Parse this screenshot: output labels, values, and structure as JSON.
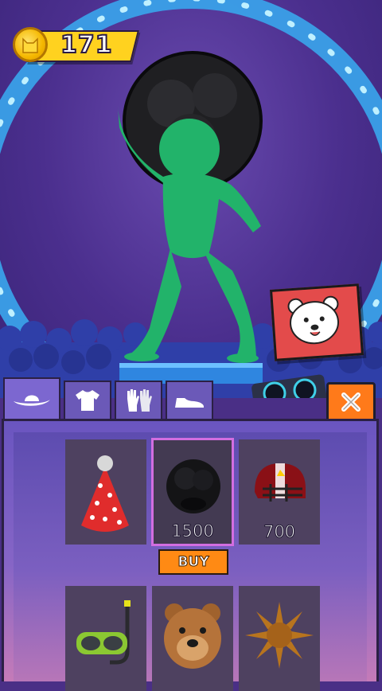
{
  "currency": {
    "coins": "171",
    "icon": "cat-coin-icon"
  },
  "tabs": [
    {
      "id": "hats",
      "icon": "cowboy-hat-icon",
      "active": true
    },
    {
      "id": "shirts",
      "icon": "tshirt-icon",
      "active": false
    },
    {
      "id": "gloves",
      "icon": "gloves-icon",
      "active": false
    },
    {
      "id": "shoes",
      "icon": "shoe-icon",
      "active": false
    }
  ],
  "shop": {
    "items": [
      {
        "name": "party-hat",
        "price": ""
      },
      {
        "name": "afro-wig",
        "price": "1500",
        "selected": true
      },
      {
        "name": "football-helmet",
        "price": "700"
      },
      {
        "name": "snorkel-mask",
        "price": ""
      },
      {
        "name": "bear-mask",
        "price": ""
      },
      {
        "name": "sun-hat",
        "price": ""
      }
    ],
    "buy_label": "BUY"
  },
  "colors": {
    "accent_orange": "#ff8a14",
    "coin_yellow": "#ffd21f",
    "character_green": "#22b36a",
    "selected_border": "#d26ee0"
  }
}
